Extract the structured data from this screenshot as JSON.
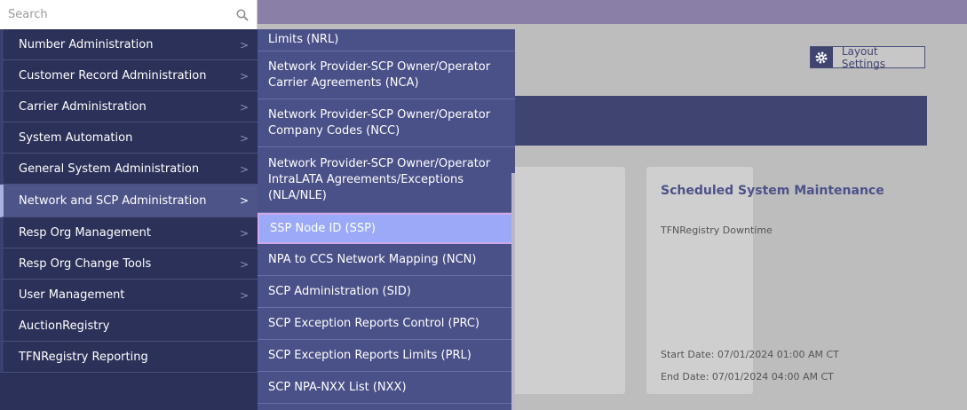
{
  "search": {
    "placeholder": "Search"
  },
  "menu": {
    "items": [
      {
        "label": "Number Administration",
        "chevron": ">"
      },
      {
        "label": "Customer Record Administration",
        "chevron": ">"
      },
      {
        "label": "Carrier Administration",
        "chevron": ">"
      },
      {
        "label": "System Automation",
        "chevron": ">"
      },
      {
        "label": "General System Administration",
        "chevron": ">"
      },
      {
        "label": "Network and SCP Administration",
        "chevron": ">"
      },
      {
        "label": "Resp Org Management",
        "chevron": ">"
      },
      {
        "label": "Resp Org Change Tools",
        "chevron": ">"
      },
      {
        "label": "User Management",
        "chevron": ">"
      },
      {
        "label": "AuctionRegistry",
        "chevron": ""
      },
      {
        "label": "TFNRegistry Reporting",
        "chevron": ""
      }
    ]
  },
  "submenu": {
    "items": [
      {
        "label": "Limits (NRL)"
      },
      {
        "label": "Network Provider-SCP Owner/Operator Carrier Agreements (NCA)"
      },
      {
        "label": "Network Provider-SCP Owner/Operator Company Codes (NCC)"
      },
      {
        "label": "Network Provider-SCP Owner/Operator IntraLATA Agreements/Exceptions (NLA/NLE)"
      },
      {
        "label": "SSP Node ID (SSP)"
      },
      {
        "label": "NPA to CCS Network Mapping (NCN)"
      },
      {
        "label": "SCP Administration (SID)"
      },
      {
        "label": "SCP Exception Reports Control (PRC)"
      },
      {
        "label": "SCP Exception Reports Limits (PRL)"
      },
      {
        "label": "SCP NPA-NXX List (NXX)"
      }
    ]
  },
  "layout_settings": {
    "label": "Layout Settings"
  },
  "maintenance": {
    "title": "Scheduled System Maintenance",
    "subtitle": "TFNRegistry Downtime",
    "start": "Start Date: 07/01/2024 01:00 AM CT",
    "end": "End Date:  07/01/2024 04:00 AM CT"
  },
  "colors": {
    "menu_bg": "#2b3158",
    "submenu_bg": "#4a5088",
    "selected": "#9aaaf8",
    "topbar": "#8a7fa6"
  }
}
